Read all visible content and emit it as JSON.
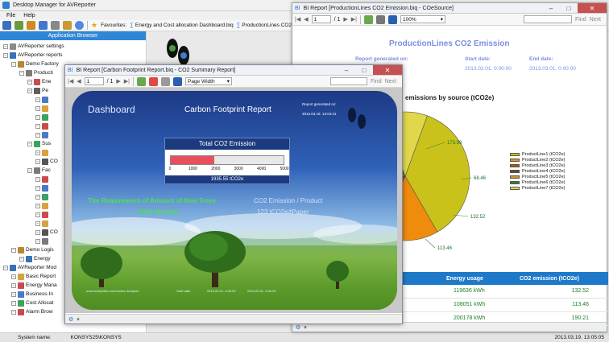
{
  "main": {
    "title": "Desktop Manager for AVReporter",
    "menu": [
      "File",
      "Help"
    ],
    "favourites_label": "Favourites:",
    "favourites": [
      "Energy and Cost allocation Dashboard.biq",
      "ProductionLines CO2 Emission"
    ],
    "panel_header": "Application Browser",
    "tree": [
      {
        "label": "AVReporter settings",
        "indent": 0,
        "color": "#8a8a8a"
      },
      {
        "label": "AVReporter reports",
        "indent": 0,
        "color": "#3b6fb6"
      },
      {
        "label": "Demo Factory",
        "indent": 1,
        "color": "#b8862c"
      },
      {
        "label": "Producti",
        "indent": 2,
        "color": "#7a7a7a"
      },
      {
        "label": "Ene",
        "indent": 3,
        "color": "#c94b4b"
      },
      {
        "label": "Pe",
        "indent": 3,
        "color": "#5f5f5f"
      },
      {
        "label": "",
        "indent": 4,
        "color": "#4c79c4"
      },
      {
        "label": "",
        "indent": 4,
        "color": "#d8a33c"
      },
      {
        "label": "",
        "indent": 4,
        "color": "#3aa35d"
      },
      {
        "label": "",
        "indent": 4,
        "color": "#c94b4b"
      },
      {
        "label": "",
        "indent": 4,
        "color": "#4c79c4"
      },
      {
        "label": "Sus",
        "indent": 3,
        "color": "#3aa35d"
      },
      {
        "label": "",
        "indent": 4,
        "color": "#d8a33c"
      },
      {
        "label": "CO",
        "indent": 4,
        "color": "#555555"
      },
      {
        "label": "Fac",
        "indent": 3,
        "color": "#7a7a7a"
      },
      {
        "label": "",
        "indent": 4,
        "color": "#c94b4b"
      },
      {
        "label": "",
        "indent": 4,
        "color": "#4c79c4"
      },
      {
        "label": "",
        "indent": 4,
        "color": "#3aa35d"
      },
      {
        "label": "",
        "indent": 4,
        "color": "#d8a33c"
      },
      {
        "label": "",
        "indent": 4,
        "color": "#c94b4b"
      },
      {
        "label": "",
        "indent": 4,
        "color": "#d8a33c"
      },
      {
        "label": "CO",
        "indent": 4,
        "color": "#555555"
      },
      {
        "label": "",
        "indent": 4,
        "color": "#7a7a7a"
      },
      {
        "label": "Demo Logis",
        "indent": 1,
        "color": "#b8862c"
      },
      {
        "label": "Energy",
        "indent": 2,
        "color": "#3b6fb6"
      },
      {
        "label": "AVReporter Mod",
        "indent": 0,
        "color": "#3b6fb6"
      },
      {
        "label": "Basic Report",
        "indent": 1,
        "color": "#d8a33c"
      },
      {
        "label": "Energy Mana",
        "indent": 1,
        "color": "#c94b4b"
      },
      {
        "label": "Business-In",
        "indent": 1,
        "color": "#4c79c4"
      },
      {
        "label": "Cost Allocat",
        "indent": 1,
        "color": "#3aa35d"
      },
      {
        "label": "Alarm Brow",
        "indent": 1,
        "color": "#c94b4b"
      }
    ],
    "status_label": "System name:",
    "status_value": "KONSYS25\\KONSYS",
    "status_time": "2013.03.19. 13:05:05"
  },
  "win_right": {
    "title": "BI Report [ProductionLines CO2 Emission.biq - COeSource]",
    "page": "1",
    "page_of": "/ 1",
    "zoom": "100%",
    "find": "Find",
    "next": "Next",
    "report_title": "ProductionLines CO2 Emission",
    "generated_label": "Report generated on:",
    "start_label": "Start date:",
    "end_label": "End date:",
    "start_value": "2013.02.01. 0:00:00",
    "end_value": "2013.03.01. 0:00:00",
    "chart_title_fragment": "emissions by source (tCO2e)",
    "table_headers": [
      "Energy usage",
      "CO2 emission (tCO2e)"
    ],
    "table_rows": [
      {
        "usage": "119636 kWh",
        "co2": "132.52"
      },
      {
        "usage": "108051 kWh",
        "co2": "113.46"
      },
      {
        "usage": "200178 kWh",
        "co2": "190.21"
      }
    ]
  },
  "chart_data": {
    "type": "pie",
    "title": "emissions by source (tCO2e)",
    "data_labels": [
      "173.93",
      "68.46",
      "132.52",
      "113.46"
    ],
    "series": [
      {
        "name": "ProductLine1 (tCO2e)",
        "color": "#c9c21a"
      },
      {
        "name": "ProductLine2 (tCO2e)",
        "color": "#f08c0c"
      },
      {
        "name": "ProductLine3 (tCO2e)",
        "color": "#a35a12"
      },
      {
        "name": "ProductLine4 (tCO2e)",
        "color": "#6b4a22"
      },
      {
        "name": "ProductLine5 (tCO2e)",
        "color": "#d49a20"
      },
      {
        "name": "ProductLine6 (tCO2e)",
        "color": "#2f7f2f"
      },
      {
        "name": "ProductLine7 (tCO2e)",
        "color": "#e0d84a"
      }
    ]
  },
  "win_front": {
    "title": "BI Report [Carbon Footprint Report.biq - CO2 Summary Report]",
    "page": "1",
    "page_of": "/ 1",
    "zoom": "Page Width",
    "find": "Find",
    "next": "Next",
    "dashboard_label": "Dashboard",
    "report_title": "Carbon Footprint Report",
    "generated_label": "Report generated on:",
    "generated_value": "2013.03.19.   13:04:41",
    "gauge_title": "Total CO2 Emission",
    "gauge_ticks": [
      "0",
      "1000",
      "2000",
      "3000",
      "4000",
      "5000"
    ],
    "gauge_value": "1935.55 tCO2e",
    "gauge_fraction": 0.387,
    "trees_label": "The Requirement of Amount of New Trees",
    "trees_value": "2315.44 trees",
    "co2_product_label": "CO2 Emission / Product",
    "co2_product_value": "123 tCO2e/tPaper",
    "footer_left": "www.avreporter.com/carbon-footprint",
    "footer_mid": "Start date",
    "footer_date1": "2013.02.01. 0:00:00",
    "footer_date2": "2013.03.01. 0:00:00"
  },
  "colors": {
    "accent": "#1e7ac9",
    "dashboard_bg_top": "#1f3f8a",
    "grass": "#5a9a2a",
    "gauge_fill": "#e8505b",
    "title_green": "#49e34e"
  }
}
